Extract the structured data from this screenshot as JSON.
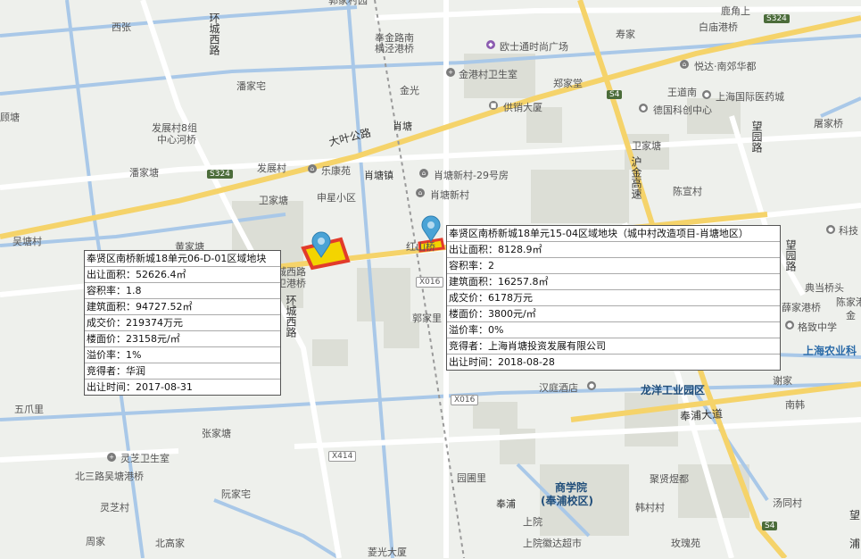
{
  "map": {
    "labels": {
      "xizhang": "西张",
      "huancheng_xilu_top": "环城西路",
      "fengjin_nan": "奉金路南",
      "hengjing_gangqiao": "横泾港桥",
      "jiajia_yuan": "郭家村园",
      "ouji": "欧士通时尚广场",
      "shou_jia": "寿家",
      "baimiao": "白庙港桥",
      "luji": "鹿角上",
      "jingangcun": "金港村卫生室",
      "jinguang": "金光",
      "zhengjiatang": "郑家堂",
      "yuehe": "悦达·南郊华都",
      "wangdao": "王道南",
      "pan_jia_zhai": "潘家宅",
      "yuan_xiangmu": "顾塘",
      "gongxiao": "供销大厦",
      "dekuo": "德国科创中心",
      "shanghai_yiyao": "上海国际医药城",
      "wangyuan_top": "望园路",
      "fazhan": "发展村8组",
      "zhongxin": "中心河桥",
      "daye_gonglu": "大叶公路",
      "xiaotang_station": "肖塘",
      "weijia": "卫家塘",
      "juwujia": "屠家桥",
      "fanjia": "潘家塘",
      "fazhancun": "发展村",
      "lekang": "乐康苑",
      "xiaotang_zhen": "肖塘镇",
      "xiaotang_xincun29": "肖塘新村-29号房",
      "hujin": "沪金高速",
      "chenzhai": "陈宣村",
      "weijiatang": "卫家塘",
      "shenxing": "申星小区",
      "xiaotang_xincun": "肖塘新村",
      "wutang": "吴塘村",
      "huangjia": "黄家塘",
      "hongshan": "红山桥",
      "keji": "科技",
      "huancheng_xi_left": "城西路",
      "weigang": "卫港桥",
      "huancheng_xilu_vert": "环城西路",
      "wangyuanlu": "望园路",
      "dianbao": "典当桥头",
      "xuejia": "薛家港桥",
      "chenjia": "陈家港",
      "gejing": "格致中学",
      "jin": "金",
      "guojiali": "郭家里",
      "shanghai_nongye": "上海农业科",
      "hanting": "汉庭酒店",
      "longyang": "龙洋工业园区",
      "xie": "谢家",
      "nanhan": "南韩",
      "wuguali": "五爪里",
      "zhangjiatang": "张家塘",
      "fengpu_dadao": "奉浦大道",
      "lingzhi_clinic": "灵芝卫生室",
      "beisanlu": "北三路吴塘港桥",
      "ruanjia": "阮家宅",
      "yuanpi": "园圃里",
      "shangxueyuan": "商学院",
      "shangxueyuan_sub": "(奉浦校区)",
      "juxian": "聚贤煜都",
      "tangtong": "汤同村",
      "lingzhicun": "灵芝村",
      "fengpu_station": "奉浦",
      "hancun": "韩村村",
      "zhoujia": "周家",
      "beigao": "北高家",
      "shangyuan": "上院",
      "lingguang": "菱光大厦",
      "shangyuan_hui": "上院徽达超市",
      "meiguiyuan": "玫瑰苑",
      "wang": "望",
      "pu": "浦"
    },
    "road_badges": {
      "s324_left": "S324",
      "s324_right": "S324",
      "s4_top": "S4",
      "s4_bottom": "S4",
      "x016_a": "X016",
      "x016_b": "X016",
      "x414": "X414"
    }
  },
  "infobox_left": {
    "title": "奉贤区南桥新城18单元06-D-01区域地块",
    "rows": [
      "出让面积：52626.4㎡",
      "容积率：1.8",
      "建筑面积：94727.52㎡",
      "成交价：219374万元",
      "楼面价：23158元/㎡",
      "溢价率：1%",
      "竞得者：华润",
      "出让时间：2017-08-31"
    ]
  },
  "infobox_right": {
    "title": "奉贤区南桥新城18单元15-04区域地块（城中村改造项目-肖塘地区）",
    "rows": [
      "出让面积：8128.9㎡",
      "容积率：2",
      "建筑面积：16257.8㎡",
      "成交价：6178万元",
      "楼面价：3800元/㎡",
      "溢价率：0%",
      "竞得者：上海肖塘投资发展有限公司",
      "出让时间：2018-08-28"
    ]
  },
  "colors": {
    "water": "#a9c8e8",
    "highway": "#f5d36a",
    "block": "#d9dcd3",
    "parcel_fill": "#f3d400",
    "parcel_border": "#e23b2b",
    "pin": "#4aa3d6"
  }
}
